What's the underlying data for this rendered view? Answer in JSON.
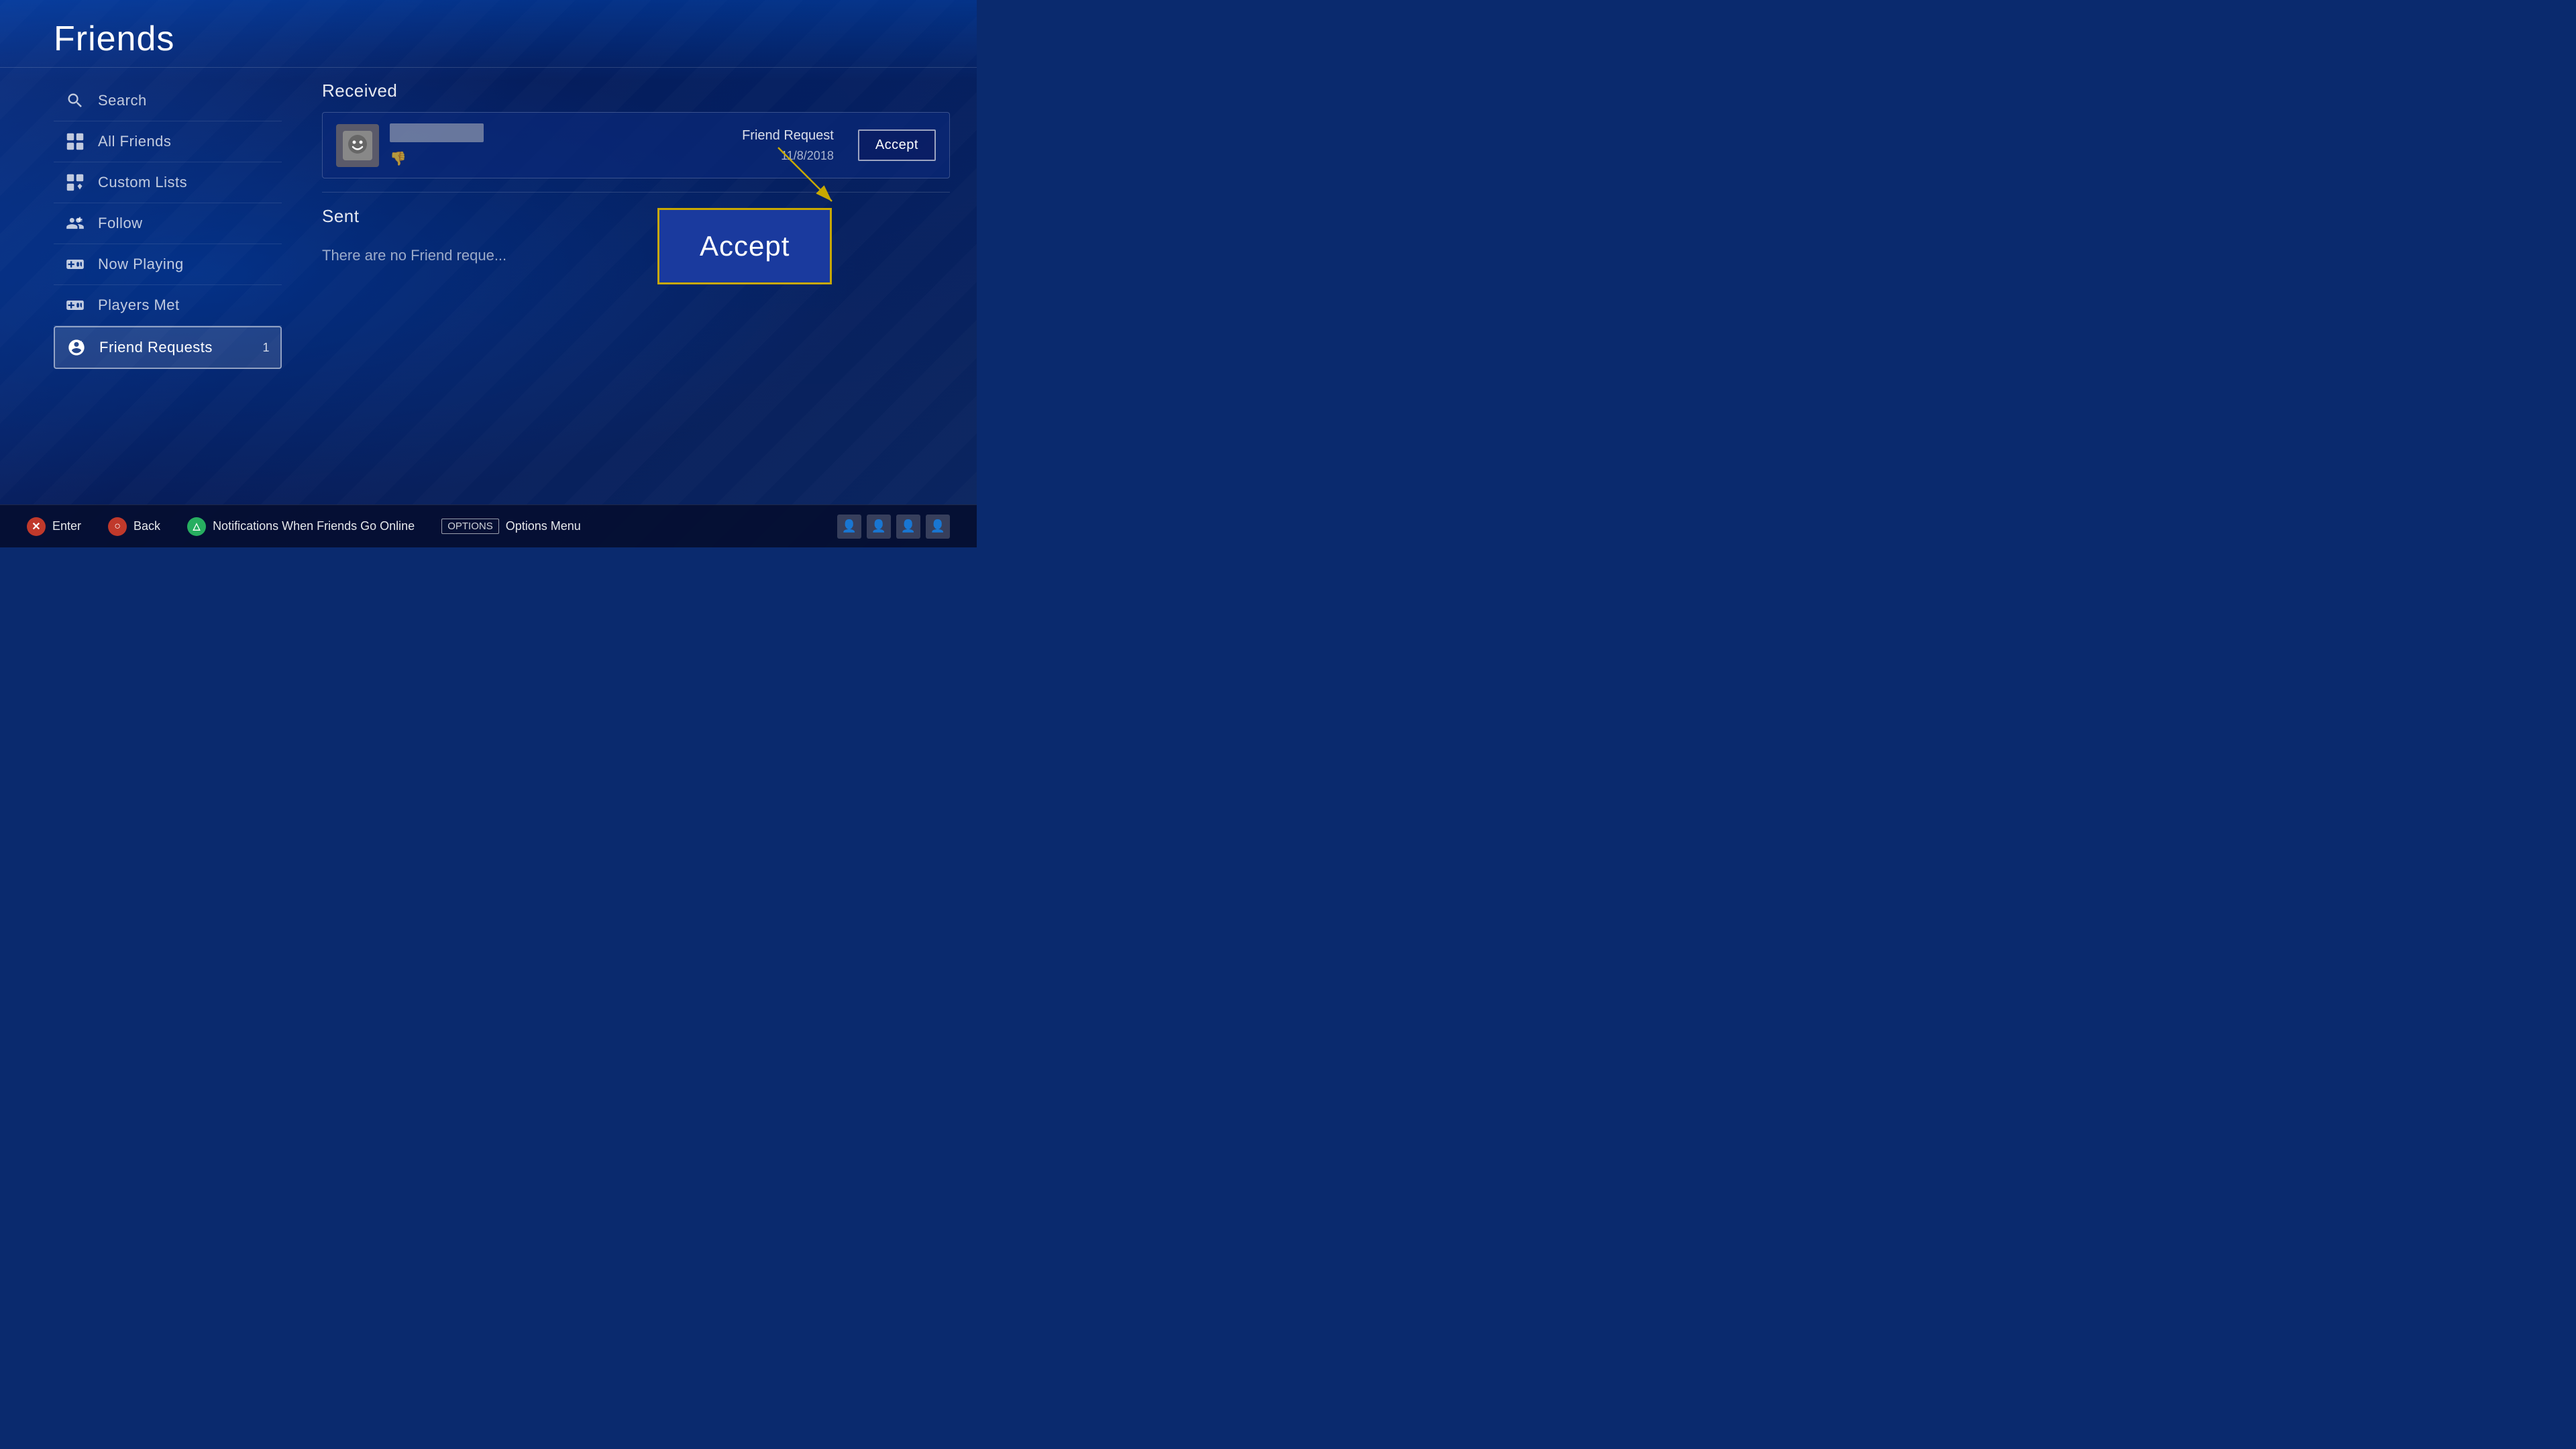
{
  "page": {
    "title": "Friends",
    "title_line_color": "rgba(255,255,255,0.15)"
  },
  "sidebar": {
    "items": [
      {
        "id": "search",
        "label": "Search",
        "icon": "search",
        "active": false,
        "badge": null
      },
      {
        "id": "all-friends",
        "label": "All Friends",
        "icon": "friends",
        "active": false,
        "badge": null
      },
      {
        "id": "custom-lists",
        "label": "Custom Lists",
        "icon": "custom-lists",
        "active": false,
        "badge": null
      },
      {
        "id": "follow",
        "label": "Follow",
        "icon": "follow",
        "active": false,
        "badge": null
      },
      {
        "id": "now-playing",
        "label": "Now Playing",
        "icon": "controller",
        "active": false,
        "badge": null
      },
      {
        "id": "players-met",
        "label": "Players Met",
        "icon": "controller",
        "active": false,
        "badge": null
      },
      {
        "id": "friend-requests",
        "label": "Friend Requests",
        "icon": "friend-request",
        "active": true,
        "badge": "1"
      }
    ]
  },
  "main": {
    "received_label": "Received",
    "sent_label": "Sent",
    "request": {
      "type": "Friend Request",
      "date": "11/8/2018",
      "accept_label": "Accept"
    },
    "sent_empty_text": "There are no Friend reque...",
    "accept_highlight_label": "Accept"
  },
  "bottom_bar": {
    "controls": [
      {
        "id": "enter",
        "btn": "X",
        "label": "Enter",
        "color": "#c0392b"
      },
      {
        "id": "back",
        "btn": "O",
        "label": "Back",
        "color": "#c0392b"
      },
      {
        "id": "notifications",
        "btn": "△",
        "label": "Notifications When Friends Go Online",
        "color": "#27ae60"
      }
    ],
    "options_label": "OPTIONS",
    "options_menu_label": "Options Menu"
  }
}
